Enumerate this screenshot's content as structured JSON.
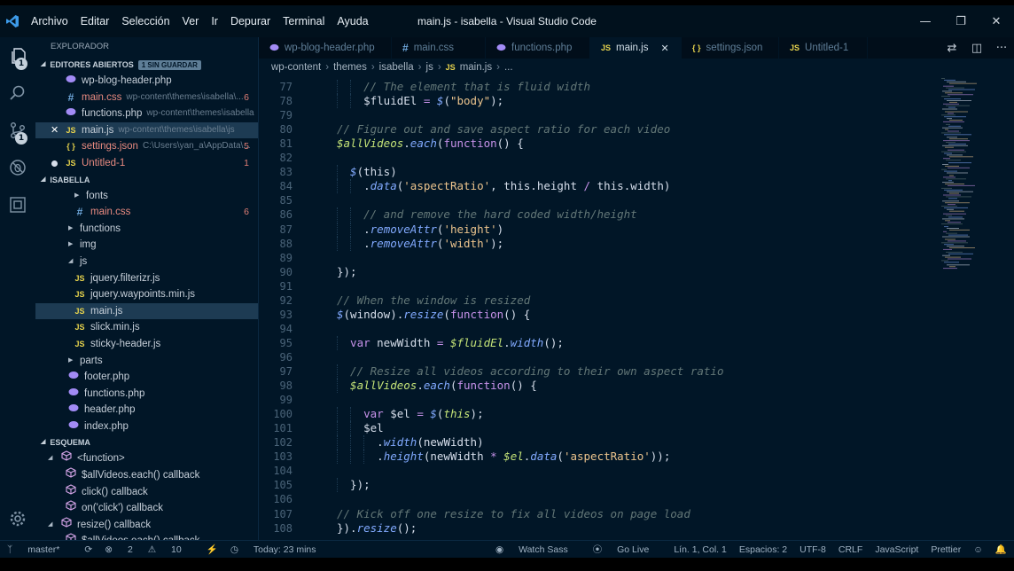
{
  "window": {
    "title": "main.js - isabella - Visual Studio Code",
    "menu": [
      "Archivo",
      "Editar",
      "Selección",
      "Ver",
      "Ir",
      "Depurar",
      "Terminal",
      "Ayuda"
    ]
  },
  "activity": {
    "explorer_badge": "1",
    "scm_badge": "1"
  },
  "explorer": {
    "title": "EXPLORADOR",
    "open_editors": {
      "title": "EDITORES ABIERTOS",
      "badge": "1 SIN GUARDAR",
      "items": [
        {
          "icon": "php",
          "name": "wp-blog-header.php",
          "path": "",
          "count": ""
        },
        {
          "icon": "css",
          "name": "main.css",
          "path": "wp-content\\themes\\isabella\\...",
          "count": "6"
        },
        {
          "icon": "php",
          "name": "functions.php",
          "path": "wp-content\\themes\\isabella",
          "count": ""
        },
        {
          "icon": "js",
          "name": "main.js",
          "path": "wp-content\\themes\\isabella\\js",
          "count": "",
          "selected": true,
          "close": true
        },
        {
          "icon": "json",
          "name": "settings.json",
          "path": "C:\\Users\\yan_a\\AppData\\...",
          "count": "5"
        },
        {
          "icon": "js",
          "name": "Untitled-1",
          "path": "",
          "count": "1",
          "dirty": true
        }
      ]
    },
    "project": {
      "title": "ISABELLA",
      "items": [
        {
          "type": "folder",
          "name": "fonts",
          "indent": 2,
          "open": false
        },
        {
          "type": "css",
          "name": "main.css",
          "indent": 2,
          "count": "6"
        },
        {
          "type": "folder",
          "name": "functions",
          "indent": 1,
          "open": false
        },
        {
          "type": "folder",
          "name": "img",
          "indent": 1,
          "open": false
        },
        {
          "type": "folder",
          "name": "js",
          "indent": 1,
          "open": true
        },
        {
          "type": "js",
          "name": "jquery.filterizr.js",
          "indent": 2
        },
        {
          "type": "js",
          "name": "jquery.waypoints.min.js",
          "indent": 2
        },
        {
          "type": "js",
          "name": "main.js",
          "indent": 2,
          "selected": true
        },
        {
          "type": "js",
          "name": "slick.min.js",
          "indent": 2
        },
        {
          "type": "js",
          "name": "sticky-header.js",
          "indent": 2
        },
        {
          "type": "folder",
          "name": "parts",
          "indent": 1,
          "open": false
        },
        {
          "type": "php",
          "name": "footer.php",
          "indent": 1
        },
        {
          "type": "php",
          "name": "functions.php",
          "indent": 1
        },
        {
          "type": "php",
          "name": "header.php",
          "indent": 1
        },
        {
          "type": "php",
          "name": "index.php",
          "indent": 1
        }
      ]
    },
    "outline": {
      "title": "ESQUEMA",
      "items": [
        {
          "name": "<function>",
          "indent": 1,
          "open": true
        },
        {
          "name": "$allVideos.each() callback",
          "indent": 2
        },
        {
          "name": "click() callback",
          "indent": 2
        },
        {
          "name": "on('click') callback",
          "indent": 2
        },
        {
          "name": "resize() callback",
          "indent": 1,
          "open": true
        },
        {
          "name": "$allVideos.each() callback",
          "indent": 2
        }
      ]
    }
  },
  "tabs": [
    {
      "icon": "php",
      "name": "wp-blog-header.php"
    },
    {
      "icon": "css",
      "name": "main.css"
    },
    {
      "icon": "php",
      "name": "functions.php"
    },
    {
      "icon": "js",
      "name": "main.js",
      "active": true
    },
    {
      "icon": "json",
      "name": "settings.json"
    },
    {
      "icon": "js",
      "name": "Untitled-1",
      "dirty": true
    }
  ],
  "breadcrumb": [
    "wp-content",
    "themes",
    "isabella",
    "js",
    "main.js",
    "..."
  ],
  "code": [
    {
      "n": "77",
      "i": 2,
      "t": [
        [
          "cm",
          "// The element that is fluid width"
        ]
      ]
    },
    {
      "n": "78",
      "i": 2,
      "t": [
        [
          "vr",
          "$fluidEl"
        ],
        [
          "op",
          " = "
        ],
        [
          "fn",
          "$"
        ],
        [
          "dl",
          "("
        ],
        [
          "st",
          "\"body\""
        ],
        [
          "dl",
          ");"
        ]
      ]
    },
    {
      "n": "79",
      "i": 0,
      "t": []
    },
    {
      "n": "80",
      "i": 0,
      "t": [
        [
          "cm",
          "// Figure out and save aspect ratio for each video"
        ]
      ]
    },
    {
      "n": "81",
      "i": 0,
      "t": [
        [
          "it",
          "$allVideos"
        ],
        [
          "dl",
          "."
        ],
        [
          "fn",
          "each"
        ],
        [
          "dl",
          "("
        ],
        [
          "kw",
          "function"
        ],
        [
          "dl",
          "() {"
        ]
      ]
    },
    {
      "n": "82",
      "i": 0,
      "t": []
    },
    {
      "n": "83",
      "i": 1,
      "t": [
        [
          "fn",
          "$"
        ],
        [
          "dl",
          "("
        ],
        [
          "vr",
          "this"
        ],
        [
          "dl",
          ")"
        ]
      ]
    },
    {
      "n": "84",
      "i": 2,
      "t": [
        [
          "dl",
          "."
        ],
        [
          "fn",
          "data"
        ],
        [
          "dl",
          "("
        ],
        [
          "st",
          "'aspectRatio'"
        ],
        [
          "dl",
          ", "
        ],
        [
          "vr",
          "this"
        ],
        [
          "dl",
          ".height "
        ],
        [
          "op",
          "/"
        ],
        [
          "vr",
          " this"
        ],
        [
          "dl",
          ".width)"
        ]
      ]
    },
    {
      "n": "85",
      "i": 0,
      "t": []
    },
    {
      "n": "86",
      "i": 2,
      "t": [
        [
          "cm",
          "// and remove the hard coded width/height"
        ]
      ]
    },
    {
      "n": "87",
      "i": 2,
      "t": [
        [
          "dl",
          "."
        ],
        [
          "fn",
          "removeAttr"
        ],
        [
          "dl",
          "("
        ],
        [
          "st",
          "'height'"
        ],
        [
          "dl",
          ")"
        ]
      ]
    },
    {
      "n": "88",
      "i": 2,
      "t": [
        [
          "dl",
          "."
        ],
        [
          "fn",
          "removeAttr"
        ],
        [
          "dl",
          "("
        ],
        [
          "st",
          "'width'"
        ],
        [
          "dl",
          ");"
        ]
      ]
    },
    {
      "n": "89",
      "i": 0,
      "t": []
    },
    {
      "n": "90",
      "i": 0,
      "t": [
        [
          "dl",
          "});"
        ]
      ]
    },
    {
      "n": "91",
      "i": 0,
      "t": []
    },
    {
      "n": "92",
      "i": 0,
      "t": [
        [
          "cm",
          "// When the window is resized"
        ]
      ]
    },
    {
      "n": "93",
      "i": 0,
      "t": [
        [
          "fn",
          "$"
        ],
        [
          "dl",
          "(window)."
        ],
        [
          "fn",
          "resize"
        ],
        [
          "dl",
          "("
        ],
        [
          "kw",
          "function"
        ],
        [
          "dl",
          "() {"
        ]
      ]
    },
    {
      "n": "94",
      "i": 0,
      "t": []
    },
    {
      "n": "95",
      "i": 1,
      "t": [
        [
          "kw",
          "var"
        ],
        [
          "vr",
          " newWidth"
        ],
        [
          "op",
          " = "
        ],
        [
          "it",
          "$fluidEl"
        ],
        [
          "dl",
          "."
        ],
        [
          "fn",
          "width"
        ],
        [
          "dl",
          "();"
        ]
      ]
    },
    {
      "n": "96",
      "i": 0,
      "t": []
    },
    {
      "n": "97",
      "i": 1,
      "t": [
        [
          "cm",
          "// Resize all videos according to their own aspect ratio"
        ]
      ]
    },
    {
      "n": "98",
      "i": 1,
      "t": [
        [
          "it",
          "$allVideos"
        ],
        [
          "dl",
          "."
        ],
        [
          "fn",
          "each"
        ],
        [
          "dl",
          "("
        ],
        [
          "kw",
          "function"
        ],
        [
          "dl",
          "() {"
        ]
      ]
    },
    {
      "n": "99",
      "i": 0,
      "t": []
    },
    {
      "n": "100",
      "i": 2,
      "t": [
        [
          "kw",
          "var"
        ],
        [
          "vr",
          " $el"
        ],
        [
          "op",
          " = "
        ],
        [
          "fn",
          "$"
        ],
        [
          "dl",
          "("
        ],
        [
          "it",
          "this"
        ],
        [
          "dl",
          ");"
        ]
      ]
    },
    {
      "n": "101",
      "i": 2,
      "t": [
        [
          "vr",
          "$el"
        ]
      ]
    },
    {
      "n": "102",
      "i": 3,
      "t": [
        [
          "dl",
          "."
        ],
        [
          "fn",
          "width"
        ],
        [
          "dl",
          "(newWidth)"
        ]
      ]
    },
    {
      "n": "103",
      "i": 3,
      "t": [
        [
          "dl",
          "."
        ],
        [
          "fn",
          "height"
        ],
        [
          "dl",
          "(newWidth "
        ],
        [
          "op",
          "*"
        ],
        [
          "it",
          " $el"
        ],
        [
          "dl",
          "."
        ],
        [
          "fn",
          "data"
        ],
        [
          "dl",
          "("
        ],
        [
          "st",
          "'aspectRatio'"
        ],
        [
          "dl",
          "));"
        ]
      ]
    },
    {
      "n": "104",
      "i": 0,
      "t": []
    },
    {
      "n": "105",
      "i": 1,
      "t": [
        [
          "dl",
          "});"
        ]
      ]
    },
    {
      "n": "106",
      "i": 0,
      "t": []
    },
    {
      "n": "107",
      "i": 0,
      "t": [
        [
          "cm",
          "// Kick off one resize to fix all videos on page load"
        ]
      ]
    },
    {
      "n": "108",
      "i": 0,
      "t": [
        [
          "dl",
          "})."
        ],
        [
          "fn",
          "resize"
        ],
        [
          "dl",
          "();"
        ]
      ]
    }
  ],
  "status": {
    "branch": "master*",
    "errors": "2",
    "warnings": "10",
    "today": "Today: 23 mins",
    "watch": "Watch Sass",
    "golive": "Go Live",
    "position": "Lín. 1, Col. 1",
    "spaces": "Espacios: 2",
    "encoding": "UTF-8",
    "eol": "CRLF",
    "language": "JavaScript",
    "formatter": "Prettier"
  },
  "colors": {
    "bg": "#011627",
    "accent": "#82aaff",
    "string": "#ecc48d",
    "keyword": "#c792ea",
    "comment": "#637777"
  }
}
